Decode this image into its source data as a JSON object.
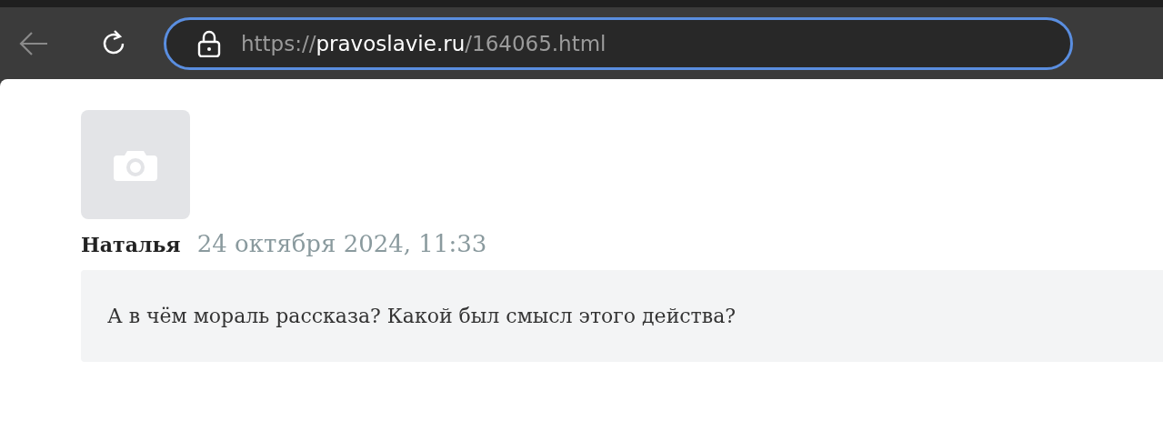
{
  "browser": {
    "address_bar": {
      "scheme": "https://",
      "host": "pravoslavie.ru",
      "path": "/164065.html",
      "focused": true
    }
  },
  "comment": {
    "author": "Наталья",
    "date": "24 октября 2024, 11:33",
    "text": "А в чём мораль рассказа? Какой был смысл этого действа?"
  }
}
